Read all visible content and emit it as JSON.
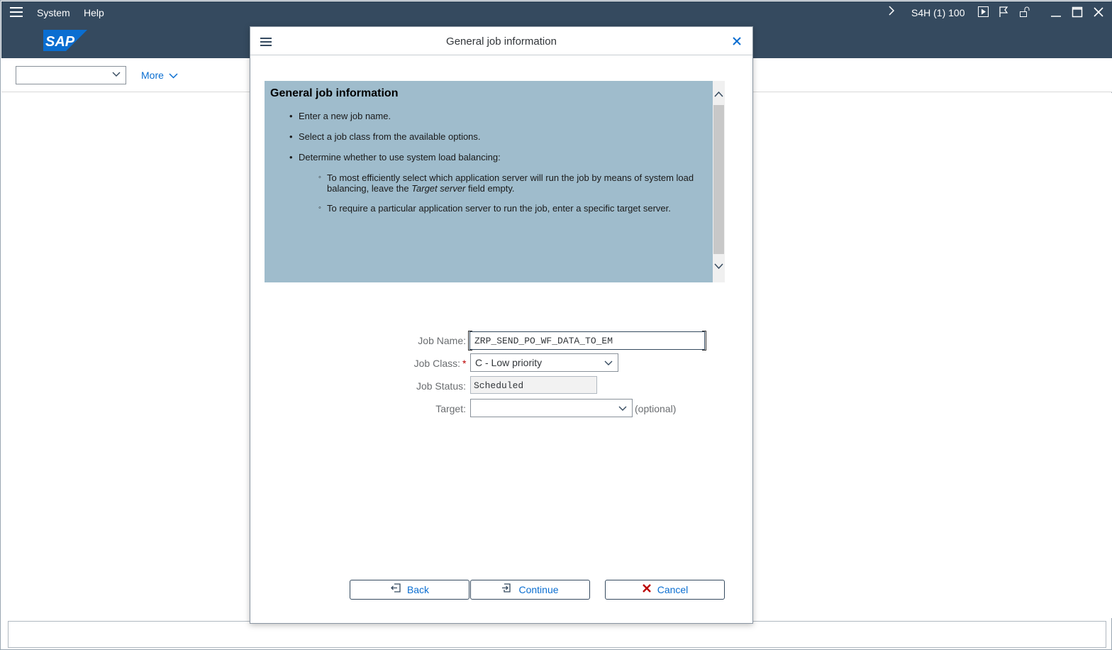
{
  "menubar": {
    "items": [
      "System",
      "Help"
    ],
    "system_info": "S4H (1) 100",
    "icons": [
      "menu-icon",
      "chevron-right-icon",
      "play-icon",
      "flag-icon",
      "unlock-icon",
      "minimize-icon",
      "maximize-icon",
      "close-icon"
    ]
  },
  "logo": {
    "text": "SAP",
    "color": "#0a6ed1"
  },
  "toolbar": {
    "command_value": "",
    "more_label": "More"
  },
  "dialog": {
    "title": "General job information",
    "help": {
      "title": "General job information",
      "bullets": [
        "Enter a new job name.",
        "Select a job class from the available options.",
        "Determine whether to use system load balancing:"
      ],
      "sub_bullet_1_pre": "To most efficiently select which application server will run the job by means of system load balancing, leave the ",
      "sub_bullet_1_em": "Target server",
      "sub_bullet_1_post": " field empty.",
      "sub_bullet_2": "To require a particular application server to run the job, enter a specific target server."
    },
    "form": {
      "job_name_label": "Job Name:",
      "job_name_value": "ZRP_SEND_PO_WF_DATA_TO_EM",
      "job_class_label": "Job Class:",
      "job_class_required": "*",
      "job_class_value": "C - Low priority",
      "job_status_label": "Job Status:",
      "job_status_value": "Scheduled",
      "target_label": "Target:",
      "target_value": "",
      "target_hint": "(optional)"
    },
    "buttons": {
      "back": "Back",
      "continue": "Continue",
      "cancel": "Cancel"
    }
  },
  "colors": {
    "shell": "#354a5f",
    "help_bg": "#9fbccc",
    "link": "#0a6ed1",
    "cancel_x": "#bb0000"
  }
}
